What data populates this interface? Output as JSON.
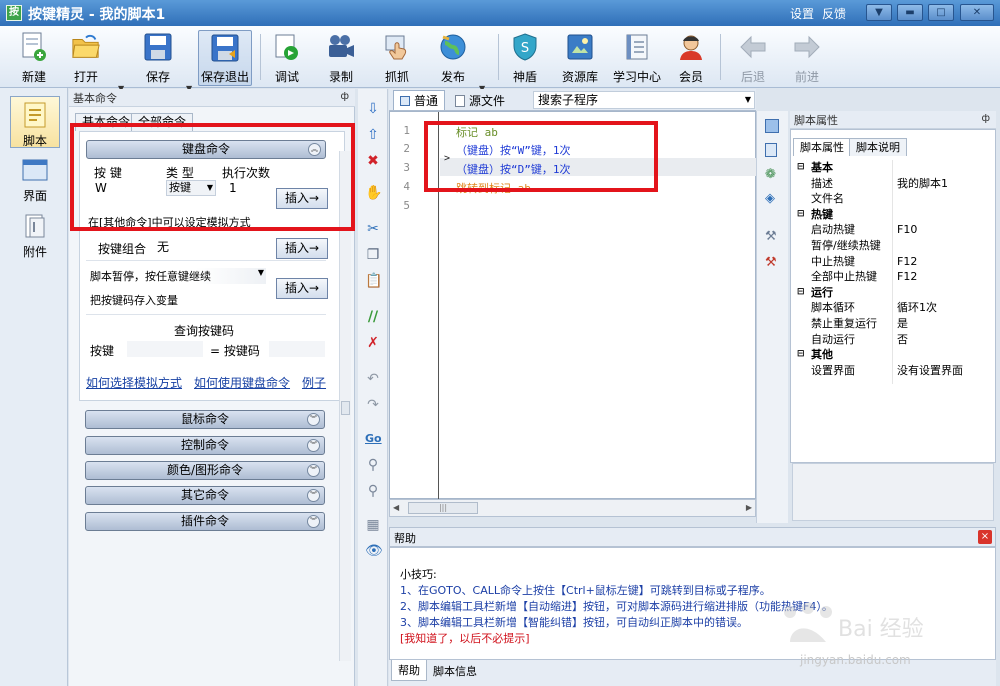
{
  "window": {
    "app_icon_glyph": "按",
    "title": "按键精灵 - 我的脚本1",
    "links": [
      "设置",
      "反馈"
    ]
  },
  "toolbar": {
    "new": "新建",
    "open": "打开",
    "save": "保存",
    "save_exit": "保存退出",
    "debug": "调试",
    "record": "录制",
    "capture": "抓抓",
    "publish": "发布",
    "shield": "神盾",
    "resources": "资源库",
    "learn": "学习中心",
    "member": "会员",
    "back": "后退",
    "forward": "前进"
  },
  "left_strip": {
    "script": "脚本",
    "ui": "界面",
    "attachment": "附件"
  },
  "command_panel": {
    "header": "基本命令",
    "pin": "ф",
    "tabs": [
      "基本命令",
      "全部命令"
    ],
    "keyboard_group": "键盘命令",
    "key_label": "按 键",
    "type_label": "类 型",
    "count_label": "执行次数",
    "key_value": "W",
    "type_value": "按键",
    "count_value": "1",
    "insert": "插入→",
    "sim_note": "在[其他命令]中可以设定模拟方式",
    "combo_label": "按键组合",
    "combo_value": "无",
    "pause_label": "脚本暂停，按任意键继续",
    "store_label": "把按键码存入变量",
    "query_title": "查询按键码",
    "query_key": "按键",
    "query_code": "= 按键码",
    "links": [
      "如何选择模拟方式",
      "如何使用键盘命令",
      "例子"
    ],
    "groups": [
      "鼠标命令",
      "控制命令",
      "颜色/图形命令",
      "其它命令",
      "插件命令"
    ]
  },
  "editor": {
    "tabs": [
      "普通",
      "源文件"
    ],
    "search_placeholder": "搜索子程序",
    "line_numbers": [
      "1",
      "2",
      "3",
      "4",
      "5"
    ],
    "lines": [
      "标记 ab",
      "（键盘）按“W”键，1次",
      "（键盘）按“D”键，1次",
      "跳转到标记 ab",
      ""
    ]
  },
  "help": {
    "title": "帮助",
    "close": "×",
    "tip_title": "小技巧:",
    "tips": [
      "1、在GOTO、CALL命令上按住【Ctrl+鼠标左键】可跳转到目标或子程序。",
      "2、脚本编辑工具栏新增【自动缩进】按钮，可对脚本源码进行缩进排版（功能热键F4）。",
      "3、脚本编辑工具栏新增【智能纠错】按钮，可自动纠正脚本中的错误。"
    ],
    "dismiss": "[我知道了，以后不必提示]",
    "tabs": [
      "帮助",
      "脚本信息"
    ]
  },
  "properties": {
    "header": "脚本属性",
    "pin": "ф",
    "tabs": [
      "脚本属性",
      "脚本说明"
    ],
    "rows": [
      {
        "cat": "基本"
      },
      {
        "k": "描述",
        "v": "我的脚本1"
      },
      {
        "k": "文件名",
        "v": ""
      },
      {
        "cat": "热键"
      },
      {
        "k": "启动热键",
        "v": "F10"
      },
      {
        "k": "暂停/继续热键",
        "v": ""
      },
      {
        "k": "中止热键",
        "v": "F12"
      },
      {
        "k": "全部中止热键",
        "v": "F12"
      },
      {
        "cat": "运行"
      },
      {
        "k": "脚本循环",
        "v": "循环1次"
      },
      {
        "k": "禁止重复运行",
        "v": "是"
      },
      {
        "k": "自动运行",
        "v": "否"
      },
      {
        "cat": "其他"
      },
      {
        "k": "设置界面",
        "v": "没有设置界面"
      }
    ]
  },
  "watermark": {
    "logo_text": "Bai 经验",
    "url": "jingyan.baidu.com"
  },
  "colors": {
    "accent": "#2f6fb8",
    "highlight_box": "#e3141b",
    "code_blue": "#1f3bd6",
    "code_orange": "#e0851d",
    "code_green": "#6a8f2a",
    "help_blue": "#1c3fa6",
    "dismiss_red": "#d0101a"
  }
}
